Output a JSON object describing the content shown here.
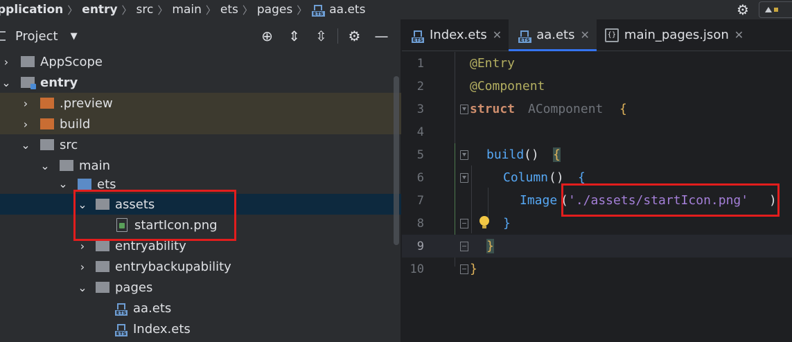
{
  "breadcrumb": {
    "items": [
      "pplication",
      "entry",
      "src",
      "main",
      "ets",
      "pages",
      "aa.ets"
    ]
  },
  "project_panel": {
    "title": "Project",
    "tree": [
      {
        "label": "AppScope",
        "depth": 0,
        "expanded": false,
        "icon": "folder-grey"
      },
      {
        "label": "entry",
        "depth": 0,
        "expanded": true,
        "icon": "module-folder"
      },
      {
        "label": ".preview",
        "depth": 1,
        "expanded": false,
        "icon": "folder-orange"
      },
      {
        "label": "build",
        "depth": 1,
        "expanded": false,
        "icon": "folder-orange"
      },
      {
        "label": "src",
        "depth": 1,
        "expanded": true,
        "icon": "folder-grey"
      },
      {
        "label": "main",
        "depth": 2,
        "expanded": true,
        "icon": "folder-grey"
      },
      {
        "label": "ets",
        "depth": 3,
        "expanded": true,
        "icon": "folder-blue"
      },
      {
        "label": "assets",
        "depth": 4,
        "expanded": true,
        "icon": "folder-grey"
      },
      {
        "label": "startIcon.png",
        "depth": 5,
        "icon": "png-file"
      },
      {
        "label": "entryability",
        "depth": 4,
        "expanded": false,
        "icon": "folder-grey"
      },
      {
        "label": "entrybackupability",
        "depth": 4,
        "expanded": false,
        "icon": "folder-grey"
      },
      {
        "label": "pages",
        "depth": 4,
        "expanded": true,
        "icon": "folder-grey"
      },
      {
        "label": "aa.ets",
        "depth": 5,
        "icon": "ets-file"
      },
      {
        "label": "Index.ets",
        "depth": 5,
        "icon": "ets-file"
      }
    ]
  },
  "editor": {
    "tabs": [
      {
        "label": "Index.ets",
        "active": false,
        "icon": "ets-file"
      },
      {
        "label": "aa.ets",
        "active": true,
        "icon": "ets-file"
      },
      {
        "label": "main_pages.json",
        "active": false,
        "icon": "json-file"
      }
    ],
    "line_numbers": [
      "1",
      "2",
      "3",
      "4",
      "5",
      "6",
      "7",
      "8",
      "9",
      "10"
    ],
    "code": {
      "l1": "@Entry",
      "l2": "@Component",
      "l3_kw": "struct",
      "l3_name": "AComponent",
      "l3_brace": "{",
      "l5_fn": "build",
      "l5_paren": "()",
      "l5_brace": "{",
      "l6_fn": "Column",
      "l6_paren": "()",
      "l6_brace": "{",
      "l7_fn": "Image",
      "l7_open": "(",
      "l7_str": "'./assets/startIcon.png'",
      "l7_close": ")",
      "l8_brace": "}",
      "l9_brace": "}",
      "l10_brace": "}"
    }
  },
  "ets_label": "ETS",
  "json_label": "{}",
  "colors": {
    "highlight_box": "#e21d1d",
    "accent": "#3574f0"
  }
}
